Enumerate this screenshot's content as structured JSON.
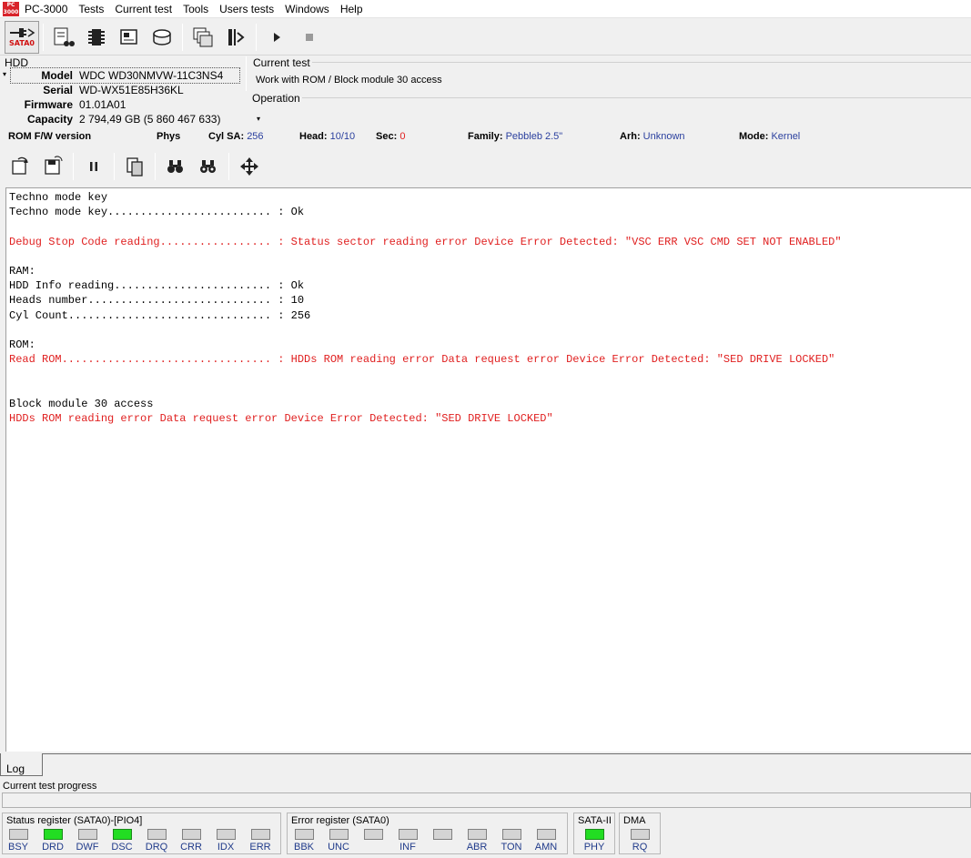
{
  "app": {
    "title": "PC-3000",
    "logo_text": "PC 3000"
  },
  "menu": [
    "Tests",
    "Current test",
    "Tools",
    "Users tests",
    "Windows",
    "Help"
  ],
  "toolbar": {
    "port_label": "SATA0"
  },
  "hdd": {
    "title": "HDD",
    "fields": [
      {
        "label": "Model",
        "value": "WDC WD30NMVW-11C3NS4"
      },
      {
        "label": "Serial",
        "value": "WD-WX51E85H36KL"
      },
      {
        "label": "Firmware",
        "value": "01.01A01"
      },
      {
        "label": "Capacity",
        "value": "2 794,49 GB (5 860 467 633)"
      }
    ]
  },
  "current_test": {
    "title": "Current test",
    "value": "Work with ROM / Block module 30 access"
  },
  "operation": {
    "title": "Operation"
  },
  "status_line": {
    "rom_fw": "ROM F/W version",
    "phys": "Phys",
    "cyl_sa_label": "Cyl SA:",
    "cyl_sa": "256",
    "head_label": "Head:",
    "head": "10/10",
    "sec_label": "Sec:",
    "sec": "0",
    "family_label": "Family:",
    "family": "Pebbleb 2.5\"",
    "arh_label": "Arh:",
    "arh": "Unknown",
    "mode_label": "Mode:",
    "mode": "Kernel"
  },
  "log": [
    {
      "text": "Techno mode key",
      "error": false
    },
    {
      "text": "Techno mode key......................... : Ok",
      "error": false
    },
    {
      "text": "",
      "error": false
    },
    {
      "text": "Debug Stop Code reading................. : Status sector reading error Device Error Detected: \"VSC ERR VSC CMD SET NOT ENABLED\"",
      "error": true
    },
    {
      "text": "",
      "error": false
    },
    {
      "text": "RAM:",
      "error": false
    },
    {
      "text": "HDD Info reading........................ : Ok",
      "error": false
    },
    {
      "text": "Heads number............................ : 10",
      "error": false
    },
    {
      "text": "Cyl Count............................... : 256",
      "error": false
    },
    {
      "text": "",
      "error": false
    },
    {
      "text": "ROM:",
      "error": false
    },
    {
      "text": "Read ROM................................ : HDDs ROM reading error Data request error Device Error Detected: \"SED DRIVE LOCKED\"",
      "error": true
    },
    {
      "text": "",
      "error": false
    },
    {
      "text": "",
      "error": false
    },
    {
      "text": "Block module 30 access",
      "error": false
    },
    {
      "text": "HDDs ROM reading error Data request error Device Error Detected: \"SED DRIVE LOCKED\"",
      "error": true
    }
  ],
  "tabs": {
    "log": "Log"
  },
  "progress": {
    "label": "Current test progress",
    "value": 0
  },
  "registers": {
    "status": {
      "title": "Status register (SATA0)-[PIO4]",
      "leds": [
        {
          "name": "BSY",
          "on": false
        },
        {
          "name": "DRD",
          "on": true
        },
        {
          "name": "DWF",
          "on": false
        },
        {
          "name": "DSC",
          "on": true
        },
        {
          "name": "DRQ",
          "on": false
        },
        {
          "name": "CRR",
          "on": false
        },
        {
          "name": "IDX",
          "on": false
        },
        {
          "name": "ERR",
          "on": false
        }
      ]
    },
    "error": {
      "title": "Error register (SATA0)",
      "leds": [
        {
          "name": "BBK",
          "on": false
        },
        {
          "name": "UNC",
          "on": false
        },
        {
          "name": "",
          "on": false
        },
        {
          "name": "INF",
          "on": false
        },
        {
          "name": "",
          "on": false
        },
        {
          "name": "ABR",
          "on": false
        },
        {
          "name": "TON",
          "on": false
        },
        {
          "name": "AMN",
          "on": false
        }
      ]
    },
    "sata": {
      "title": "SATA-II",
      "leds": [
        {
          "name": "PHY",
          "on": true
        }
      ]
    },
    "dma": {
      "title": "DMA",
      "leds": [
        {
          "name": "RQ",
          "on": false
        }
      ]
    }
  },
  "colors": {
    "error_text": "#e02020",
    "led_on": "#22dd22",
    "value_blue": "#2a3f9e"
  }
}
